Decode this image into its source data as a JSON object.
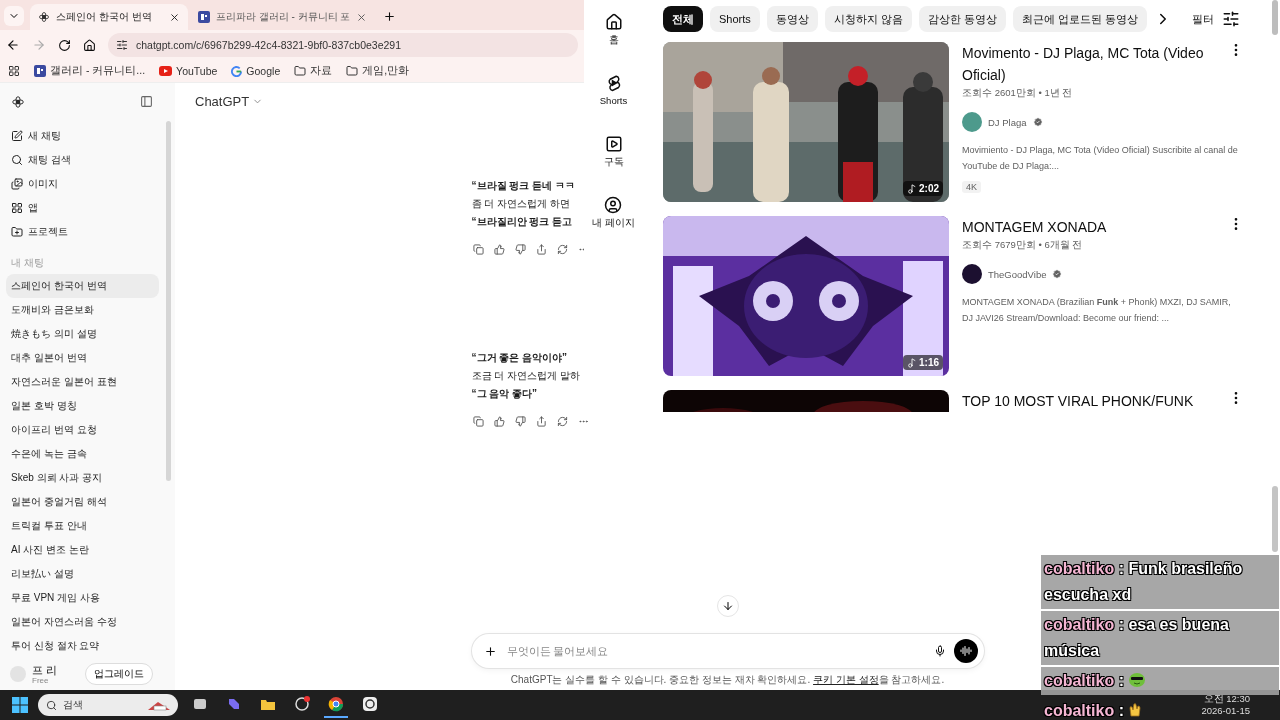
{
  "browser": {
    "tabs": [
      {
        "title": "스페인어 한국어 번역",
        "selected": true
      },
      {
        "title": "프리파라 갤러리 - 커뮤니티 포",
        "selected": false
      }
    ],
    "address": "chatgpt.com/c/6967b299-42c4-8321-9bf0-837cb0e3e291",
    "bookmarks": [
      {
        "label": "갤러리 - 커뮤니티...",
        "kind": "site"
      },
      {
        "label": "YouTube",
        "kind": "video"
      },
      {
        "label": "Google",
        "kind": "search"
      },
      {
        "label": "자료",
        "kind": "folder"
      },
      {
        "label": "게임,만화",
        "kind": "folder"
      }
    ]
  },
  "chatgpt": {
    "header": "ChatGPT",
    "nav": [
      "새 채팅",
      "채팅 검색",
      "이미지",
      "앱",
      "프로젝트"
    ],
    "section_label": "내 채팅",
    "chats": [
      {
        "title": "스페인어 한국어 번역",
        "selected": true
      },
      {
        "title": "도깨비와 금은보화",
        "selected": false
      },
      {
        "title": "焼きもち 의미 설명",
        "selected": false
      },
      {
        "title": "대추 일본어 번역",
        "selected": false
      },
      {
        "title": "자연스러운 일본어 표현",
        "selected": false
      },
      {
        "title": "일본 호박 명칭",
        "selected": false
      },
      {
        "title": "아이프리 번역 요청",
        "selected": false
      },
      {
        "title": "수은에 녹는 금속",
        "selected": false
      },
      {
        "title": "Skeb 의뢰 사과 공지",
        "selected": false
      },
      {
        "title": "일본어 중얼거림 해석",
        "selected": false
      },
      {
        "title": "트릭컬 투표 안내",
        "selected": false
      },
      {
        "title": "AI 사진 변조 논란",
        "selected": false
      },
      {
        "title": "리보払い 설명",
        "selected": false
      },
      {
        "title": "무료 VPN 게임 사용",
        "selected": false
      },
      {
        "title": "일본어 자연스러움 수정",
        "selected": false
      },
      {
        "title": "투어 신청 절차 요약",
        "selected": false
      }
    ],
    "user": {
      "name": "프 리",
      "plan": "Free"
    },
    "upgrade": "업그레이드",
    "messages": [
      {
        "lines": [
          {
            "text": "“브라질 펑크 듣네 ㅋㅋ",
            "bold": true
          },
          {
            "text": "좀 더 자연스럽게 하면",
            "bold": false
          },
          {
            "text": "“브라질리안 펑크 듣고",
            "bold": true
          }
        ]
      },
      {
        "lines": [
          {
            "text": "“그거 좋은 음악이야”",
            "bold": true
          },
          {
            "text": "조금 더 자연스럽게 말하",
            "bold": false
          },
          {
            "text": "“그 음악 좋다”",
            "bold": true
          }
        ]
      }
    ],
    "composer": {
      "placeholder": "무엇이든 물어보세요"
    },
    "disclaimer": {
      "before": "ChatGPT는 실수를 할 수 있습니다. 중요한 정보는 재차 확인하세요. ",
      "link": "쿠키 기본 설정",
      "after": "을 참고하세요."
    }
  },
  "youtube": {
    "nav": [
      "홈",
      "Shorts",
      "구독",
      "내 페이지"
    ],
    "chips": [
      {
        "label": "전체",
        "selected": true
      },
      {
        "label": "Shorts",
        "selected": false
      },
      {
        "label": "동영상",
        "selected": false
      },
      {
        "label": "시청하지 않음",
        "selected": false
      },
      {
        "label": "감상한 동영상",
        "selected": false
      },
      {
        "label": "최근에 업로드된 동영상",
        "selected": false
      }
    ],
    "filter": "필터",
    "videos": [
      {
        "title": "Movimento - DJ Plaga, MC Tota (Video Oficial)",
        "meta": "조회수 2601만회 • 1년 전",
        "channel": "DJ Plaga",
        "verified": true,
        "description": "Movimiento - DJ Plaga, MC Tota (Video Oficial) Suscribite al canal de YouTube de DJ Plaga:...",
        "badge": "4K",
        "duration": "2:02"
      },
      {
        "title": "MONTAGEM XONADA",
        "meta": "조회수 7679만회 • 6개월 전",
        "channel": "TheGoodVibe",
        "verified": true,
        "description": "MONTAGEM XONADA (Brazilian **Funk** + Phonk) MXZI, DJ SAMIR, DJ JAVI26 Stream/Download: Become our friend: ...",
        "duration": "1:16"
      },
      {
        "title": "TOP 10 MOST VIRAL PHONK/FUNK"
      }
    ]
  },
  "stream_chat": [
    {
      "user": "cobaltiko",
      "text": ": Funk brasileño escucha xd",
      "kind": "text"
    },
    {
      "user": "cobaltiko",
      "text": ": esa es buena música",
      "kind": "text"
    },
    {
      "user": "cobaltiko",
      "text": ":",
      "kind": "emote"
    },
    {
      "user": "cobaltiko",
      "text": ":",
      "kind": "emote"
    }
  ],
  "taskbar": {
    "search_placeholder": "검색",
    "apps": [
      {
        "selected": false
      },
      {
        "selected": false
      },
      {
        "selected": false
      },
      {
        "selected": false
      },
      {
        "selected": true
      },
      {
        "selected": false
      }
    ],
    "time": "오전 12:30",
    "date": "2026-01-15"
  }
}
